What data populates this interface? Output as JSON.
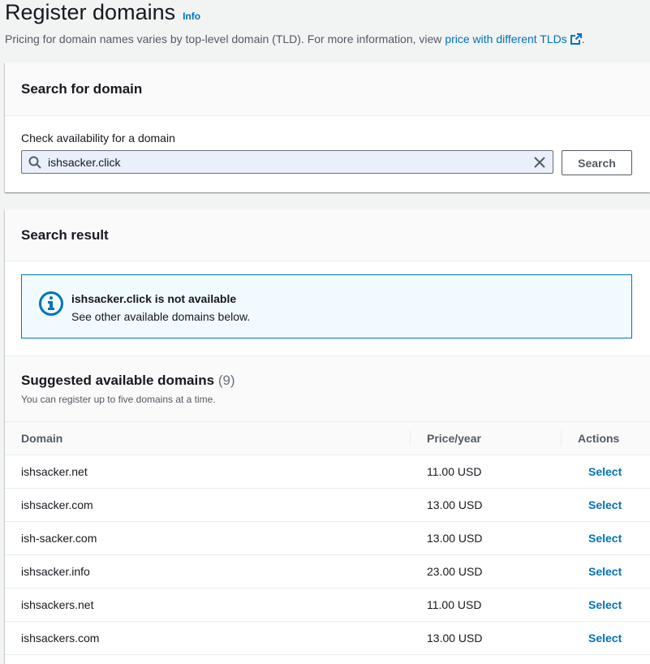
{
  "header": {
    "title": "Register domains",
    "info": "Info",
    "subtitle_prefix": "Pricing for domain names varies by top-level domain (TLD). For more information, view ",
    "subtitle_link": "price with different TLDs",
    "subtitle_suffix": "."
  },
  "search_card": {
    "title": "Search for domain",
    "field_label": "Check availability for a domain",
    "input_value": "ishsacker.click",
    "button": "Search"
  },
  "result_card": {
    "title": "Search result",
    "alert": {
      "title": "ishsacker.click is not available",
      "text": "See other available domains below."
    },
    "suggested": {
      "title": "Suggested available domains",
      "count": "(9)",
      "description": "You can register up to five domains at a time."
    },
    "table": {
      "columns": [
        "Domain",
        "Price/year",
        "Actions"
      ],
      "rows": [
        {
          "domain": "ishsacker.net",
          "price": "11.00 USD",
          "action": "Select"
        },
        {
          "domain": "ishsacker.com",
          "price": "13.00 USD",
          "action": "Select"
        },
        {
          "domain": "ish-sacker.com",
          "price": "13.00 USD",
          "action": "Select"
        },
        {
          "domain": "ishsacker.info",
          "price": "23.00 USD",
          "action": "Select"
        },
        {
          "domain": "ishsackers.net",
          "price": "11.00 USD",
          "action": "Select"
        },
        {
          "domain": "ishsackers.com",
          "price": "13.00 USD",
          "action": "Select"
        }
      ]
    }
  },
  "colors": {
    "link": "#0073bb",
    "alert_border": "#0073bb",
    "alert_bg": "#f1faff",
    "page_bg": "#f2f3f3"
  },
  "icons": [
    "external-link-icon",
    "search-icon",
    "clear-icon",
    "info-circle-icon"
  ]
}
